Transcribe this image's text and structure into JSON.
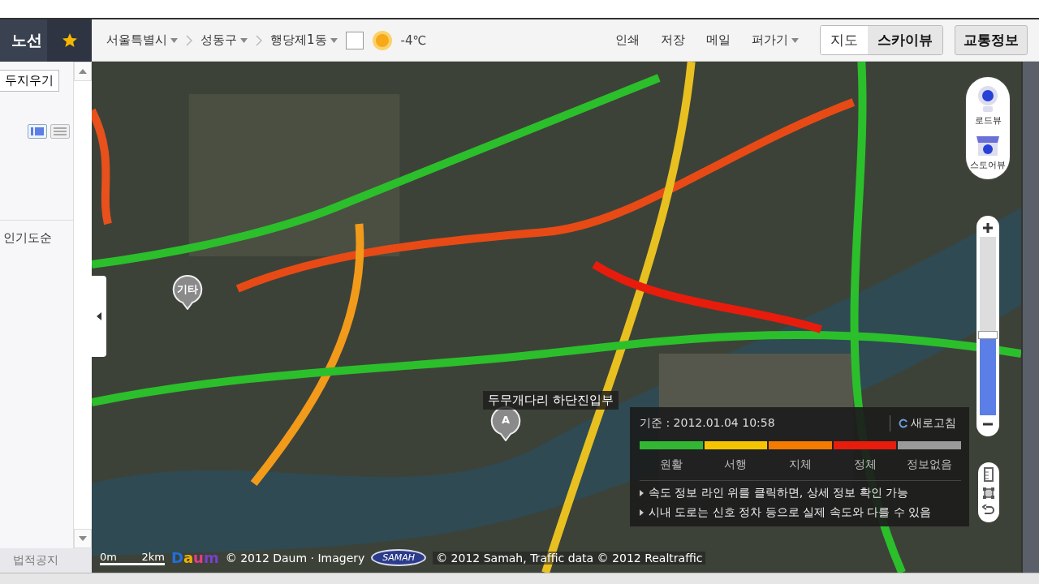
{
  "header": {
    "tab": "노선",
    "breadcrumbs": [
      {
        "label": "서울특별시"
      },
      {
        "label": "성동구"
      },
      {
        "label": "행당제1동"
      }
    ],
    "weather_checkbox": {
      "checked": false
    },
    "temperature": "-4℃",
    "actions": [
      {
        "label": "인쇄",
        "kind": "link"
      },
      {
        "label": "저장",
        "kind": "link"
      },
      {
        "label": "메일",
        "kind": "link"
      },
      {
        "label": "퍼가기",
        "kind": "menu"
      }
    ],
    "map_types": [
      {
        "label": "지도",
        "selected": false
      },
      {
        "label": "스카이뷰",
        "selected": true
      }
    ],
    "traffic_button": {
      "label": "교통정보",
      "on": true
    }
  },
  "sidebar": {
    "clear_button": "두지우기",
    "view_toggles": [
      {
        "kind": "list",
        "selected": true
      },
      {
        "kind": "detail",
        "selected": false
      }
    ],
    "sort_label": "인기도순",
    "footer_link": "법적공지"
  },
  "map": {
    "kind": "picture",
    "markers": [
      {
        "kind": "pin",
        "label": "기타"
      },
      {
        "kind": "pin",
        "label": "A"
      }
    ],
    "place_label": "두무개다리 하단진입부",
    "side_controls": [
      {
        "kind": "roadview",
        "label": "로드뷰"
      },
      {
        "kind": "storeview",
        "label": "스토어뷰"
      }
    ],
    "zoom": {
      "level": 0.45
    },
    "legend": {
      "timestamp": "기준 : 2012.01.04 10:58",
      "refresh": "새로고침",
      "levels": [
        {
          "label": "원활",
          "color": "#33b633"
        },
        {
          "label": "서행",
          "color": "#f5c400"
        },
        {
          "label": "지체",
          "color": "#f47a00"
        },
        {
          "label": "정체",
          "color": "#e81c0c"
        },
        {
          "label": "정보없음",
          "color": "#9a9a9a"
        }
      ],
      "notes": [
        "속도 정보 라인 위를 클릭하면, 상세 정보 확인 가능",
        "시내 도로는 신호 정차 등으로 실제 속도와 다를 수 있음"
      ]
    },
    "scale": {
      "start": "0m",
      "end": "2km"
    },
    "logo": "Daum",
    "copyright": "© 2012 Daum · Imagery",
    "samah_logo": "SAMAH",
    "attribution": "© 2012 Samah, Traffic data © 2012 Realtraffic"
  }
}
